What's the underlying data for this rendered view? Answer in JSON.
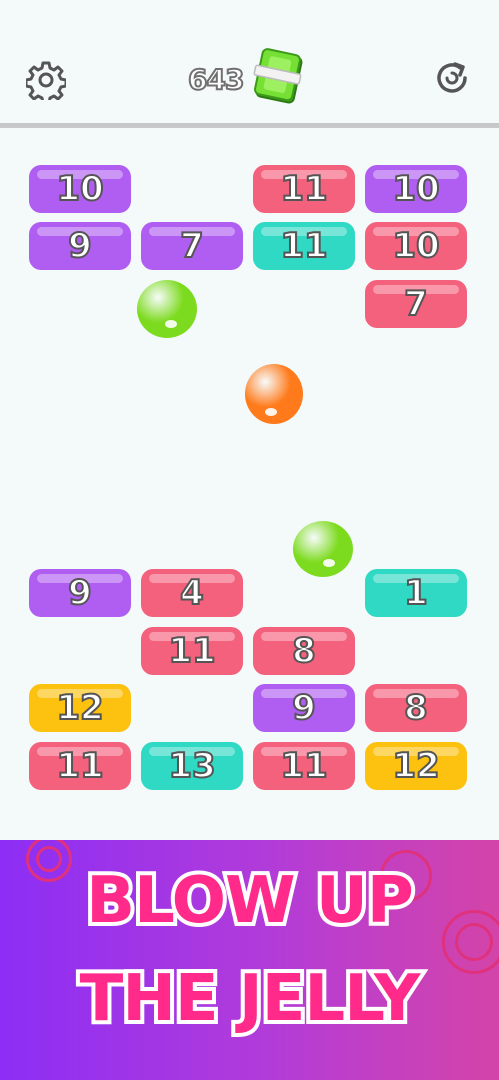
{
  "header": {
    "coin_count": "643",
    "icons": {
      "settings": "gear-icon",
      "restart": "restart-icon",
      "currency": "cash-icon"
    }
  },
  "palette": {
    "purple": "#b05ef2",
    "pink": "#f4617d",
    "teal": "#2fd9c4",
    "yellow": "#fdc10f",
    "ball_green": "#7ddb1f",
    "ball_orange": "#ff7a1a"
  },
  "board": {
    "top_blocks": [
      {
        "value": "10",
        "color": "purple"
      },
      {
        "value": "11",
        "color": "pink"
      },
      {
        "value": "10",
        "color": "purple"
      },
      {
        "value": "9",
        "color": "purple"
      },
      {
        "value": "7",
        "color": "purple"
      },
      {
        "value": "11",
        "color": "teal"
      },
      {
        "value": "10",
        "color": "pink"
      },
      {
        "value": "7",
        "color": "pink"
      }
    ],
    "bottom_blocks": [
      {
        "value": "9",
        "color": "purple"
      },
      {
        "value": "4",
        "color": "pink"
      },
      {
        "value": "1",
        "color": "teal"
      },
      {
        "value": "11",
        "color": "pink"
      },
      {
        "value": "8",
        "color": "pink"
      },
      {
        "value": "12",
        "color": "yellow"
      },
      {
        "value": "9",
        "color": "purple"
      },
      {
        "value": "8",
        "color": "pink"
      },
      {
        "value": "11",
        "color": "pink"
      },
      {
        "value": "13",
        "color": "teal"
      },
      {
        "value": "11",
        "color": "pink"
      },
      {
        "value": "12",
        "color": "yellow"
      }
    ],
    "balls": [
      {
        "color": "ball_green"
      },
      {
        "color": "ball_orange"
      },
      {
        "color": "ball_green"
      }
    ]
  },
  "banner": {
    "line1": "BLOW UP",
    "line2": "THE JELLY"
  }
}
